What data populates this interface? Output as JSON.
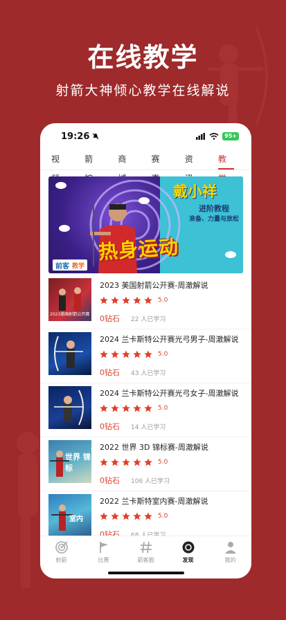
{
  "promo": {
    "title": "在线教学",
    "subtitle": "射箭大神倾心教学在线解说"
  },
  "status": {
    "time": "19:26",
    "battery": "95+"
  },
  "tabs": [
    {
      "label": "视频"
    },
    {
      "label": "箭馆"
    },
    {
      "label": "商城"
    },
    {
      "label": "赛事"
    },
    {
      "label": "资讯"
    },
    {
      "label": "教学",
      "active": true
    }
  ],
  "banner": {
    "name": "戴小祥",
    "tag1": "进阶教程",
    "tag2": "准备、力量与放松",
    "headline": "热身运动",
    "brand": "前客",
    "brand_category": "教学"
  },
  "courses": [
    {
      "title": "2023 美国射箭公开赛-周澈解说",
      "rating": "5.0",
      "price": "0钻石",
      "learners": "22 人已学习",
      "thumb_caption": "2023美国射箭公开赛"
    },
    {
      "title": "2024 兰卡斯特公开赛光弓男子-周澈解说",
      "rating": "5.0",
      "price": "0钻石",
      "learners": "43 人已学习",
      "thumb_caption": ""
    },
    {
      "title": "2024 兰卡斯特公开赛光弓女子-周澈解说",
      "rating": "5.0",
      "price": "0钻石",
      "learners": "14 人已学习",
      "thumb_caption": ""
    },
    {
      "title": "2022 世界 3D 锦标赛-周澈解说",
      "rating": "5.0",
      "price": "0钻石",
      "learners": "106 人已学习",
      "thumb_caption": "世界 锦标"
    },
    {
      "title": "2022 兰卡斯特室内赛-周澈解说",
      "rating": "5.0",
      "price": "0钻石",
      "learners": "68 人已学习",
      "thumb_caption": "室内"
    }
  ],
  "nav": [
    {
      "label": "射箭",
      "icon": "target-icon"
    },
    {
      "label": "比赛",
      "icon": "flag-icon"
    },
    {
      "label": "箭客圈",
      "icon": "hash-icon"
    },
    {
      "label": "发现",
      "icon": "discover-icon",
      "active": true
    },
    {
      "label": "我的",
      "icon": "user-icon"
    }
  ],
  "colors": {
    "background": "#9e2a2b",
    "accent": "#c93332",
    "star": "#e0402a"
  }
}
